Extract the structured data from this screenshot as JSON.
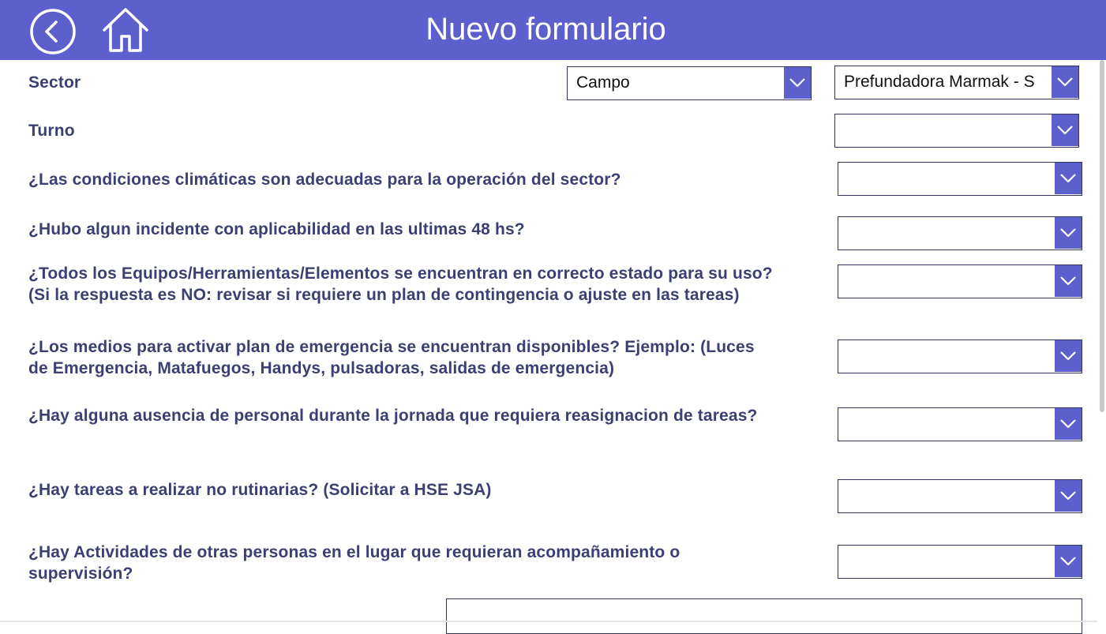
{
  "header": {
    "title": "Nuevo formulario",
    "back_icon": "back-arrow-circle-icon",
    "home_icon": "home-icon",
    "bg_color": "#5c60cc"
  },
  "form": {
    "sector": {
      "label": "Sector",
      "dropdown1_value": "Campo",
      "dropdown2_value": "Prefundadora Marmak - S"
    },
    "turno": {
      "label": "Turno",
      "value": ""
    },
    "questions": [
      {
        "text": "¿Las condiciones climáticas son adecuadas para la operación del sector?",
        "value": ""
      },
      {
        "text": "¿Hubo algun incidente con aplicabilidad en las ultimas 48 hs?",
        "value": ""
      },
      {
        "text": "¿Todos los Equipos/Herramientas/Elementos se encuentran en correcto estado para su uso? (Si la respuesta es NO: revisar si requiere un plan de contingencia o ajuste en las tareas)",
        "value": ""
      },
      {
        "text": "¿Los medios para activar plan de emergencia se encuentran disponibles? Ejemplo: (Luces de Emergencia, Matafuegos, Handys, pulsadoras, salidas de emergencia)",
        "value": ""
      },
      {
        "text": "¿Hay alguna ausencia de personal durante la jornada que requiera reasignacion de tareas?",
        "value": ""
      },
      {
        "text": "¿Hay tareas a realizar no rutinarias? (Solicitar a HSE JSA)",
        "value": ""
      },
      {
        "text": "¿Hay Actividades de otras personas en el lugar que requieran acompañamiento o supervisión?",
        "value": ""
      }
    ],
    "dropdown_icon": "chevron-down-icon",
    "accent_color": "#5c60cc",
    "label_color": "#3c3f72"
  }
}
